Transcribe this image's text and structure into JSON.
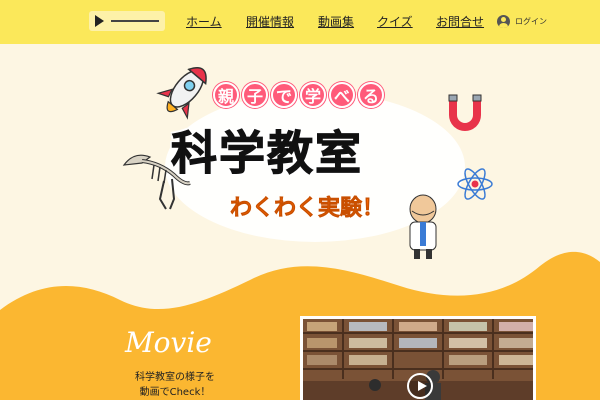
{
  "header": {
    "player": {
      "play_icon": "play-icon"
    },
    "nav": [
      "ホーム",
      "開催情報",
      "動画集",
      "クイズ",
      "お問合せ"
    ],
    "login_label": "ログイン",
    "login_icon": "user-icon"
  },
  "hero": {
    "badge_chars": [
      "親",
      "子",
      "で",
      "学",
      "べ",
      "る"
    ],
    "title": "科学教室",
    "subtitle": "わくわく実験！",
    "illustrations": [
      "rocket-illustration",
      "dinosaur-skeleton-illustration",
      "magnet-illustration",
      "atom-illustration",
      "scientist-mascot-illustration"
    ]
  },
  "movie": {
    "title": "Movie",
    "description_line1": "科学教室の様子を",
    "description_line2": "動画でCheck！",
    "play_icon": "video-play-icon"
  },
  "colors": {
    "header_bg": "#fbe85a",
    "hero_bg": "#fdf6e3",
    "wave_orange": "#fbb731",
    "accent_pink": "#ff5b7a",
    "subtitle_orange": "#ff6a00"
  }
}
